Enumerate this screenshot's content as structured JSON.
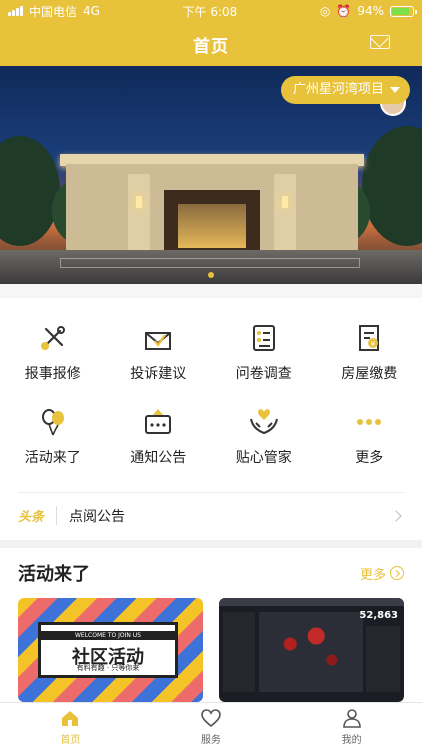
{
  "status_bar": {
    "carrier": "中国电信",
    "network": "4G",
    "time": "下午 6:08",
    "battery": "94%"
  },
  "header": {
    "title": "首页",
    "mail_icon": "mail-icon"
  },
  "banner": {
    "location_label": "广州星河湾项目"
  },
  "services": [
    {
      "label": "报事报修",
      "icon": "repair-tools-icon"
    },
    {
      "label": "投诉建议",
      "icon": "complaint-envelope-icon"
    },
    {
      "label": "问卷调查",
      "icon": "survey-checklist-icon"
    },
    {
      "label": "房屋缴费",
      "icon": "house-payment-icon"
    },
    {
      "label": "活动来了",
      "icon": "balloon-icon"
    },
    {
      "label": "通知公告",
      "icon": "notice-board-icon"
    },
    {
      "label": "贴心管家",
      "icon": "care-hands-icon"
    },
    {
      "label": "更多",
      "icon": "more-dots-icon"
    }
  ],
  "notice": {
    "tag": "头条",
    "text": "点阅公告"
  },
  "activities": {
    "title": "活动来了",
    "more_label": "更多",
    "cards": [
      {
        "banner_top": "WELCOME TO JOIN US",
        "title": "社区活动",
        "subtitle": "有料有趣 · 只等你来"
      },
      {
        "headline_number": "52,863"
      }
    ]
  },
  "tabbar": [
    {
      "label": "首页",
      "icon": "home-icon",
      "active": true
    },
    {
      "label": "服务",
      "icon": "heart-icon",
      "active": false
    },
    {
      "label": "我的",
      "icon": "user-icon",
      "active": false
    }
  ],
  "colors": {
    "accent": "#e8c23a",
    "text": "#222222"
  }
}
